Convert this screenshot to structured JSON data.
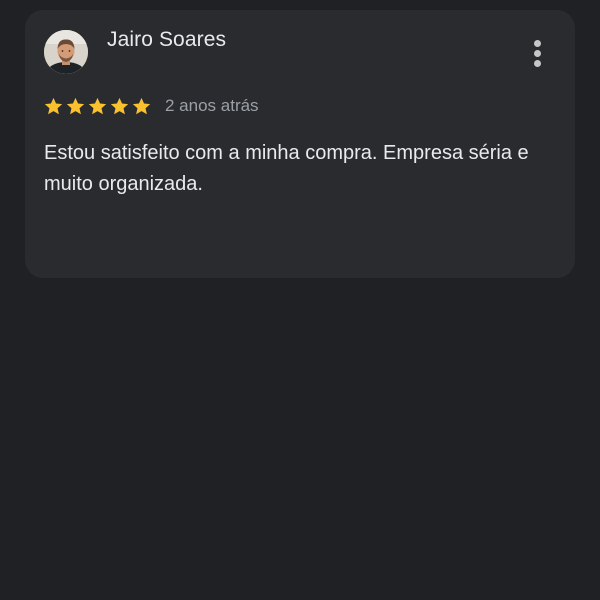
{
  "review": {
    "author_name": "Jairo Soares",
    "rating": 5,
    "rating_max": 5,
    "time": "2 anos atrás",
    "text": "Estou satisfeito com a minha compra. Empresa séria e muito organizada.",
    "avatar_icon": "user-photo-avatar",
    "menu_icon": "more-vert-icon",
    "star_icon": "star-icon"
  },
  "colors": {
    "background": "#202124",
    "card": "#2a2b2e",
    "star": "#fbc02d",
    "primary_text": "#e8eaed",
    "secondary_text": "#9aa0a6"
  }
}
